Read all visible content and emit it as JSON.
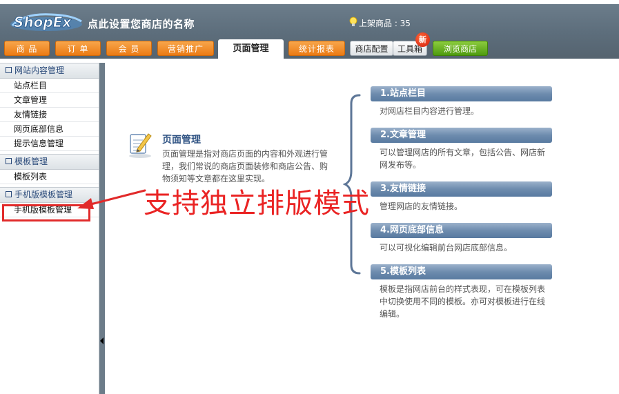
{
  "header": {
    "logo_text": "ShopEx",
    "shop_name": "点此设置您商店的名称",
    "goods_count": "上架商品 : 35",
    "new_badge": "新",
    "tabs": [
      {
        "label": "商 品"
      },
      {
        "label": "订 单"
      },
      {
        "label": "会 员"
      },
      {
        "label": "营销推广"
      },
      {
        "label": "页面管理"
      },
      {
        "label": "统计报表"
      },
      {
        "label": "商店配置"
      },
      {
        "label": "工具箱"
      },
      {
        "label": "浏览商店"
      }
    ]
  },
  "sidebar": {
    "sections": [
      {
        "title": "网站内容管理",
        "items": [
          "站点栏目",
          "文章管理",
          "友情链接",
          "网页底部信息",
          "提示信息管理"
        ]
      },
      {
        "title": "模板管理",
        "items": [
          "模板列表"
        ]
      },
      {
        "title": "手机版模板管理",
        "items": [
          "手机版模板管理"
        ]
      }
    ]
  },
  "main": {
    "intro_title": "页面管理",
    "intro_text": "页面管理是指对商店页面的内容和外观进行管理，我们常说的商店页面装修和商店公告、购物须知等文章都在这里实现。",
    "features": [
      {
        "title": "1.站点栏目",
        "desc": "对网店栏目内容进行管理。"
      },
      {
        "title": "2.文章管理",
        "desc": "可以管理网店的所有文章，包括公告、网店新网发布等。"
      },
      {
        "title": "3.友情链接",
        "desc": "管理网店的友情链接。"
      },
      {
        "title": "4.网页底部信息",
        "desc": "可以可视化编辑前台网店底部信息。"
      },
      {
        "title": "5.模板列表",
        "desc": "模板是指网店前台的样式表现，可在模板列表中切换使用不同的模板。亦可对模板进行在线编辑。"
      }
    ]
  },
  "annotation": {
    "text": "支持独立排版模式",
    "color": "#ea2323"
  },
  "colors": {
    "header_bg": "#5d6e7c",
    "tab_orange": "#ec7b14",
    "tab_green": "#4e9b10",
    "feature_header": "#6e8cae",
    "section_title": "#2a4a7a"
  }
}
